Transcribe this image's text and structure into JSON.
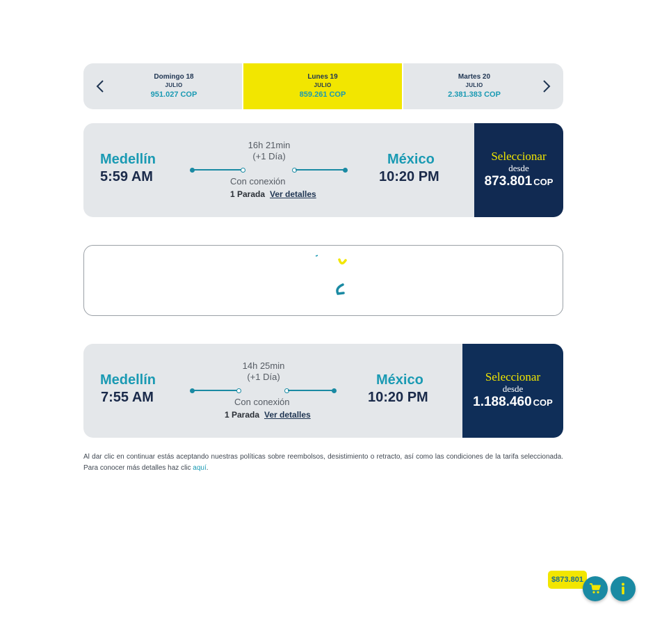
{
  "date_selector": {
    "prev_icon": "chevron-left-icon",
    "next_icon": "chevron-right-icon",
    "dates": [
      {
        "day": "Domingo 18",
        "month": "JULIO",
        "price": "951.027 COP",
        "selected": false
      },
      {
        "day": "Lunes 19",
        "month": "JULIO",
        "price": "859.261 COP",
        "selected": true
      },
      {
        "day": "Martes 20",
        "month": "JULIO",
        "price": "2.381.383 COP",
        "selected": false
      }
    ]
  },
  "flights": [
    {
      "origin_city": "Medellín",
      "departure_time": "5:59 AM",
      "duration": "16h 21min",
      "day_offset": "(+1 Día)",
      "connection": "Con conexión",
      "stops": "1 Parada",
      "details_link": "Ver detalles",
      "destination_city": "México",
      "arrival_time": "10:20 PM",
      "select_label": "Seleccionar",
      "from_label": "desde",
      "price": "873.801",
      "currency": "COP"
    },
    {
      "origin_city": "Medellín",
      "departure_time": "7:55 AM",
      "duration": "14h 25min",
      "day_offset": "(+1 Día)",
      "connection": "Con conexión",
      "stops": "1 Parada",
      "details_link": "Ver detalles",
      "destination_city": "México",
      "arrival_time": "10:20 PM",
      "select_label": "Seleccionar",
      "from_label": "desde",
      "price": "1.188.460",
      "currency": "COP"
    }
  ],
  "loading": {
    "icon": "loading-spinner-icon"
  },
  "disclaimer": {
    "text": "Al dar clic en continuar estás aceptando nuestras políticas sobre reembolsos, desistimiento o retracto, así como las condiciones de la tarifa seleccionada. Para conocer más detalles haz clic ",
    "link": "aquí",
    "end": "."
  },
  "floating": {
    "cart_total": "$873.801",
    "cart_icon": "shopping-cart-icon",
    "info_icon": "info-icon"
  },
  "colors": {
    "brand_teal": "#1a9ab3",
    "brand_yellow": "#f2e600",
    "brand_navy": "#112a52",
    "card_bg": "#e4e7ea"
  }
}
